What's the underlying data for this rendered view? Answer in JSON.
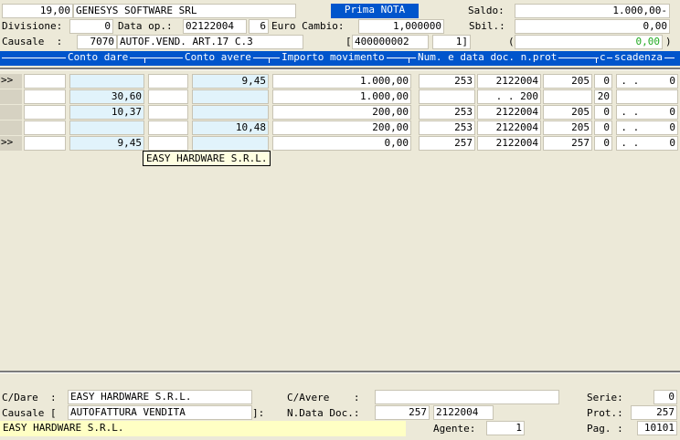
{
  "header": {
    "company_code": "19,00",
    "company_name": "GENESYS SOFTWARE SRL",
    "prima_nota_label": "Prima NOTA",
    "saldo_label": "Saldo:",
    "saldo_value": "1.000,00-",
    "divisione_label": "Divisione:",
    "divisione_value": "0",
    "data_op_label": "Data op.:",
    "data_op_value": "02122004",
    "data_op_extra": "6",
    "euro_cambio_label": "Euro Cambio:",
    "euro_cambio_value": "1,000000",
    "sbil_label": "Sbil.:",
    "sbil_value": "0,00",
    "causale_label": "Causale  :",
    "causale_code": "7070",
    "causale_desc": "AUTOF.VEND. ART.17 C.3",
    "bracket_open": "[",
    "protocol_ref": "400000002",
    "protocol_num": "1]",
    "paren_open": "(",
    "diff_value": "0,00",
    "paren_close": ")"
  },
  "grid": {
    "columns": [
      "Conto dare",
      "Conto avere",
      "Importo movimento",
      "Num. e data doc. n.prot",
      "c",
      "scadenza"
    ],
    "rows": [
      {
        "mark": ">>",
        "dare": "",
        "avere": "9,45",
        "importo": "1.000,00",
        "num": "253",
        "data": "2122004",
        "prot": "205",
        "c": "0",
        "scad": ". .     0"
      },
      {
        "mark": "",
        "dare": "30,60",
        "avere": "",
        "importo": "1.000,00",
        "num": "",
        "data": ". . 200",
        "prot": "",
        "c": "20",
        "scad": ""
      },
      {
        "mark": "",
        "dare": "10,37",
        "avere": "",
        "importo": "200,00",
        "num": "253",
        "data": "2122004",
        "prot": "205",
        "c": "0",
        "scad": ". .     0"
      },
      {
        "mark": "",
        "dare": "",
        "avere": "10,48",
        "importo": "200,00",
        "num": "253",
        "data": "2122004",
        "prot": "205",
        "c": "0",
        "scad": ". .     0"
      },
      {
        "mark": ">>",
        "dare": "9,45",
        "avere": "",
        "importo": "0,00",
        "num": "257",
        "data": "2122004",
        "prot": "257",
        "c": "0",
        "scad": ". .     0"
      }
    ],
    "tooltip": "EASY HARDWARE S.R.L."
  },
  "footer": {
    "cdare_label": "C/Dare  :",
    "cdare_value": "EASY HARDWARE S.R.L.",
    "cavere_label": "C/Avere    :",
    "cavere_value": "",
    "serie_label": "Serie:",
    "serie_value": "0",
    "causale_label": "Causale [",
    "causale_value": "AUTOFATTURA VENDITA",
    "causale_close": "]:",
    "ndata_label": "N.Data Doc.:",
    "ndata_num": "257",
    "ndata_date": "2122004",
    "prot_label": "Prot.:",
    "prot_value": "257",
    "status_text": "EASY HARDWARE S.R.L.",
    "agente_label": "Agente:",
    "agente_value": "1",
    "pag_label": "Pag. :",
    "pag_value": "10101"
  },
  "colors": {
    "prima_nota_bg": "#0055cc",
    "grid_header_bg": "#0055cc",
    "diff_green": "#22aa22",
    "status_yellow": "#ffffc4",
    "cell_blue": "#e1f3fb"
  }
}
